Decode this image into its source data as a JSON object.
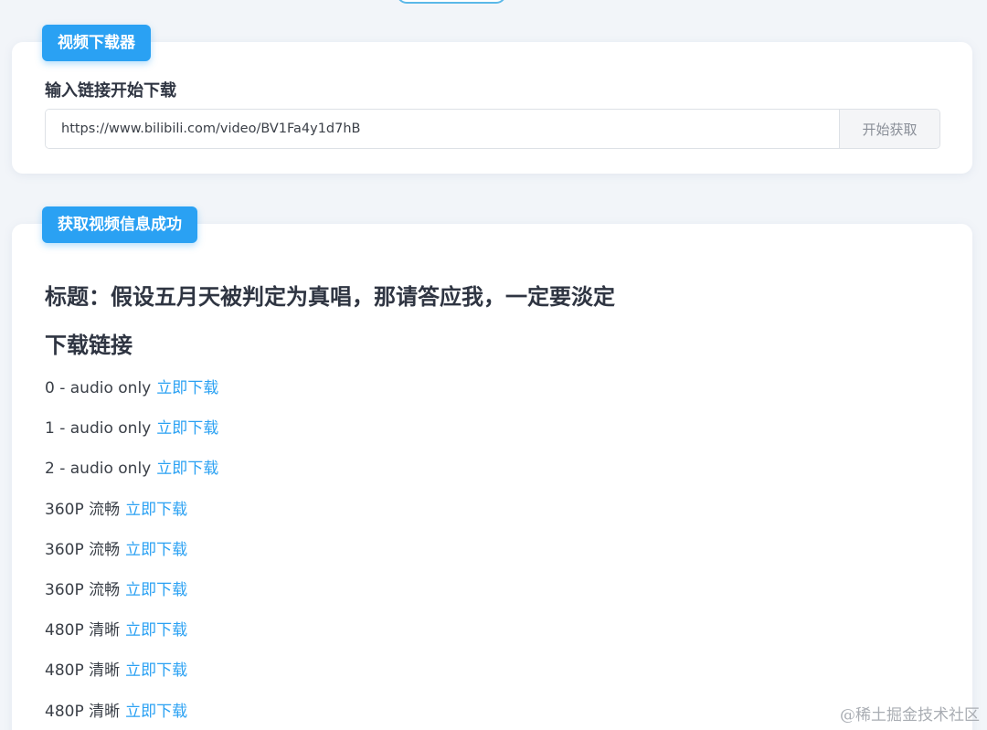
{
  "form": {
    "badge": "视频下载器",
    "label": "输入链接开始下载",
    "url_value": "https://www.bilibili.com/video/BV1Fa4y1d7hB",
    "fetch_button": "开始获取"
  },
  "result": {
    "badge": "获取视频信息成功",
    "title": "标题：假设五月天被判定为真唱，那请答应我，一定要淡定",
    "downloads_heading": "下载链接",
    "downloads": [
      {
        "label": "0 - audio only",
        "link": "立即下载"
      },
      {
        "label": "1 - audio only",
        "link": "立即下载"
      },
      {
        "label": "2 - audio only",
        "link": "立即下载"
      },
      {
        "label": "360P 流畅",
        "link": "立即下载"
      },
      {
        "label": "360P 流畅",
        "link": "立即下载"
      },
      {
        "label": "360P 流畅",
        "link": "立即下载"
      },
      {
        "label": "480P 清晰",
        "link": "立即下载"
      },
      {
        "label": "480P 清晰",
        "link": "立即下载"
      },
      {
        "label": "480P 清晰",
        "link": "立即下载"
      }
    ]
  },
  "watermark": "@稀土掘金技术社区",
  "colors": {
    "accent": "#2aa1f3",
    "background": "#f2f5f9",
    "card": "#ffffff",
    "text": "#2f3542"
  }
}
